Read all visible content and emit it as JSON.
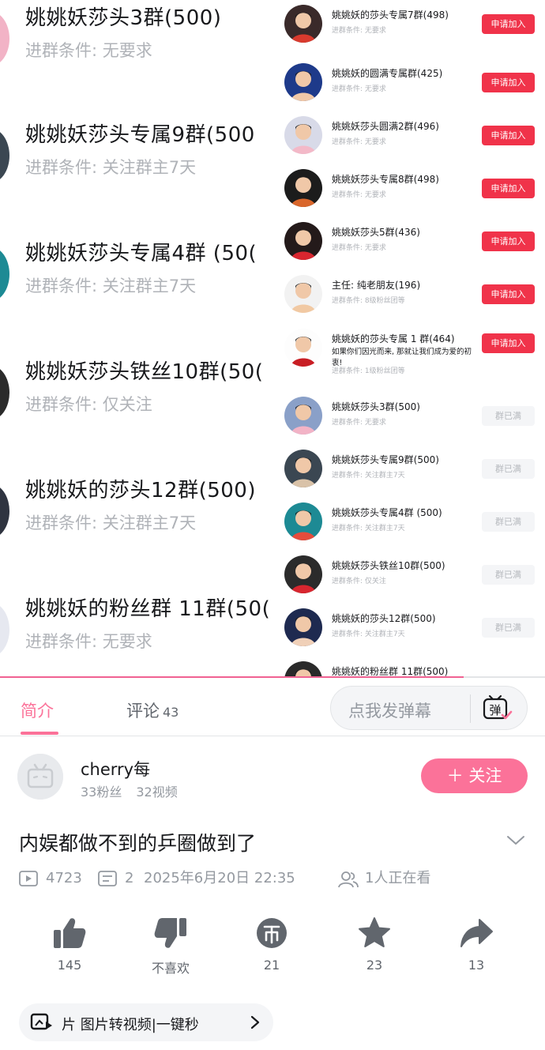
{
  "video": {
    "background_items": [
      {
        "title": "姚姚妖莎头3群(500)",
        "condition": "进群条件: 无要求",
        "avatar_color": "#f2b3c6"
      },
      {
        "title": "姚姚妖莎头专属9群(500",
        "condition": "进群条件: 关注群主7天",
        "avatar_color": "#3b4752"
      },
      {
        "title": "姚姚妖莎头专属4群 (50(",
        "condition": "进群条件: 关注群主7天",
        "avatar_color": "#1d8a94"
      },
      {
        "title": "姚姚妖莎头铁丝10群(50(",
        "condition": "进群条件: 仅关注",
        "avatar_color": "#2b2b2b"
      },
      {
        "title": "姚姚妖的莎头12群(500)",
        "condition": "进群条件: 关注群主7天",
        "avatar_color": "#2f3440"
      },
      {
        "title": "姚姚妖的粉丝群 11群(50(",
        "condition": "进群条件: 无要求",
        "avatar_color": "#e6e8f0"
      }
    ],
    "group_list": [
      {
        "title": "姚姚妖的莎头专属7群(498)",
        "condition": "进群条件: 无要求",
        "button": "申请加入",
        "status": "join",
        "avatar_bg": "#3a2a2a",
        "avatar_accent": "#d93a2e"
      },
      {
        "title": "姚姚妖的圆满专属群(425)",
        "condition": "进群条件: 无要求",
        "button": "申请加入",
        "status": "join",
        "avatar_bg": "#1e3a8a",
        "avatar_accent": "#f0c8a8"
      },
      {
        "title": "姚姚妖莎头圆满2群(496)",
        "condition": "进群条件: 无要求",
        "button": "申请加入",
        "status": "join",
        "avatar_bg": "#d8dae8",
        "avatar_accent": "#f3b9c8"
      },
      {
        "title": "姚姚妖莎头专属8群(498)",
        "condition": "进群条件: 无要求",
        "button": "申请加入",
        "status": "join",
        "avatar_bg": "#1c1c1c",
        "avatar_accent": "#d9662b"
      },
      {
        "title": "姚姚妖莎头5群(436)",
        "condition": "进群条件: 无要求",
        "button": "申请加入",
        "status": "join",
        "avatar_bg": "#241a1a",
        "avatar_accent": "#d8262f"
      },
      {
        "title": "主任: 纯老朋友(196)",
        "condition": "进群条件: 8级粉丝团等",
        "button": "申请加入",
        "status": "join",
        "avatar_bg": "#f2f2f2",
        "avatar_accent": "#f1c9a3"
      },
      {
        "title": "姚姚妖的莎头专属 1 群(464)",
        "desc": "如果你们因光而来, 那就让我们成为爱的初衷!",
        "condition": "进群条件: 1级粉丝团等",
        "button": "申请加入",
        "status": "join",
        "avatar_bg": "#fdfdfd",
        "avatar_accent": "#c81e24"
      },
      {
        "title": "姚姚妖莎头3群(500)",
        "condition": "进群条件: 无要求",
        "button": "群已满",
        "status": "full",
        "avatar_bg": "#8aa0c8",
        "avatar_accent": "#f2b3c6"
      },
      {
        "title": "姚姚妖莎头专属9群(500)",
        "condition": "进群条件: 关注群主7天",
        "button": "群已满",
        "status": "full",
        "avatar_bg": "#3b4752",
        "avatar_accent": "#d9c2a8"
      },
      {
        "title": "姚姚妖莎头专属4群 (500)",
        "condition": "进群条件: 关注群主7天",
        "button": "群已满",
        "status": "full",
        "avatar_bg": "#1d8a94",
        "avatar_accent": "#e64c3c"
      },
      {
        "title": "姚姚妖莎头铁丝10群(500)",
        "condition": "进群条件: 仅关注",
        "button": "群已满",
        "status": "full",
        "avatar_bg": "#2b2b2b",
        "avatar_accent": "#d8262f"
      },
      {
        "title": "姚姚妖的莎头12群(500)",
        "condition": "进群条件: 关注群主7天",
        "button": "群已满",
        "status": "full",
        "avatar_bg": "#1e2a50",
        "avatar_accent": "#f0d0b8"
      },
      {
        "title": "姚姚妖的粉丝群 11群(500)",
        "condition": "",
        "button": "",
        "status": "full",
        "avatar_bg": "#2a2a2a",
        "avatar_accent": "#e6e8f0"
      }
    ],
    "progress": 0.85
  },
  "tabs": {
    "intro": "简介",
    "comments": "评论",
    "comments_count": "43"
  },
  "danmaku": {
    "placeholder": "点我发弹幕",
    "icon_char": "弹"
  },
  "uploader": {
    "name": "cherry每",
    "fans": "33粉丝",
    "videos": "32视频",
    "follow_label": "＋ 关注"
  },
  "video_info": {
    "title": "内娱都做不到的乒圈做到了",
    "views": "4723",
    "danmaku_count": "2",
    "date": "2025年6月20日 22:35",
    "watching": "1人正在看"
  },
  "actions": {
    "like": "145",
    "dislike": "不喜欢",
    "coin": "21",
    "favorite": "23",
    "share": "13"
  },
  "bottom_chip": {
    "text": "片   图片转视频|一键秒"
  },
  "colors": {
    "pink": "#fb7299",
    "join_red": "#f0334a",
    "gray_text": "#9499a0"
  }
}
